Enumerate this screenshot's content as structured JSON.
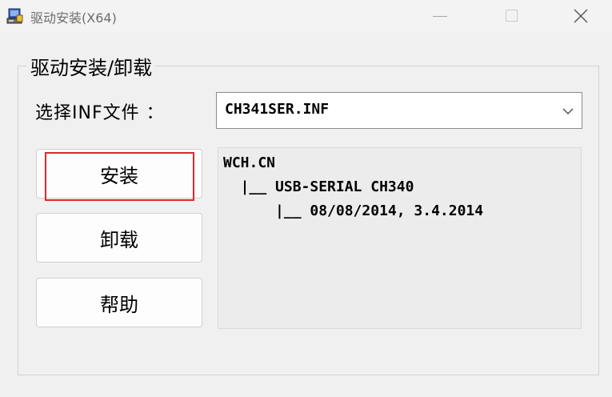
{
  "window": {
    "title": "驱动安装(X64)"
  },
  "group": {
    "title": "驱动安装/卸载"
  },
  "inf": {
    "label": "选择INF文件 ：",
    "selected": "CH341SER.INF"
  },
  "buttons": {
    "install": "安装",
    "uninstall": "卸载",
    "help": "帮助"
  },
  "info": {
    "lines": [
      "WCH.CN",
      "  |__ USB-SERIAL CH340",
      "      |__ 08/08/2014, 3.4.2014"
    ]
  },
  "colors": {
    "focus_outline": "#e0262a",
    "background": "#f0f0f0"
  },
  "icons": {
    "app": "install-driver-icon",
    "minimize": "minimize-icon",
    "maximize": "maximize-icon",
    "close": "close-icon",
    "dropdown": "chevron-down-icon"
  }
}
